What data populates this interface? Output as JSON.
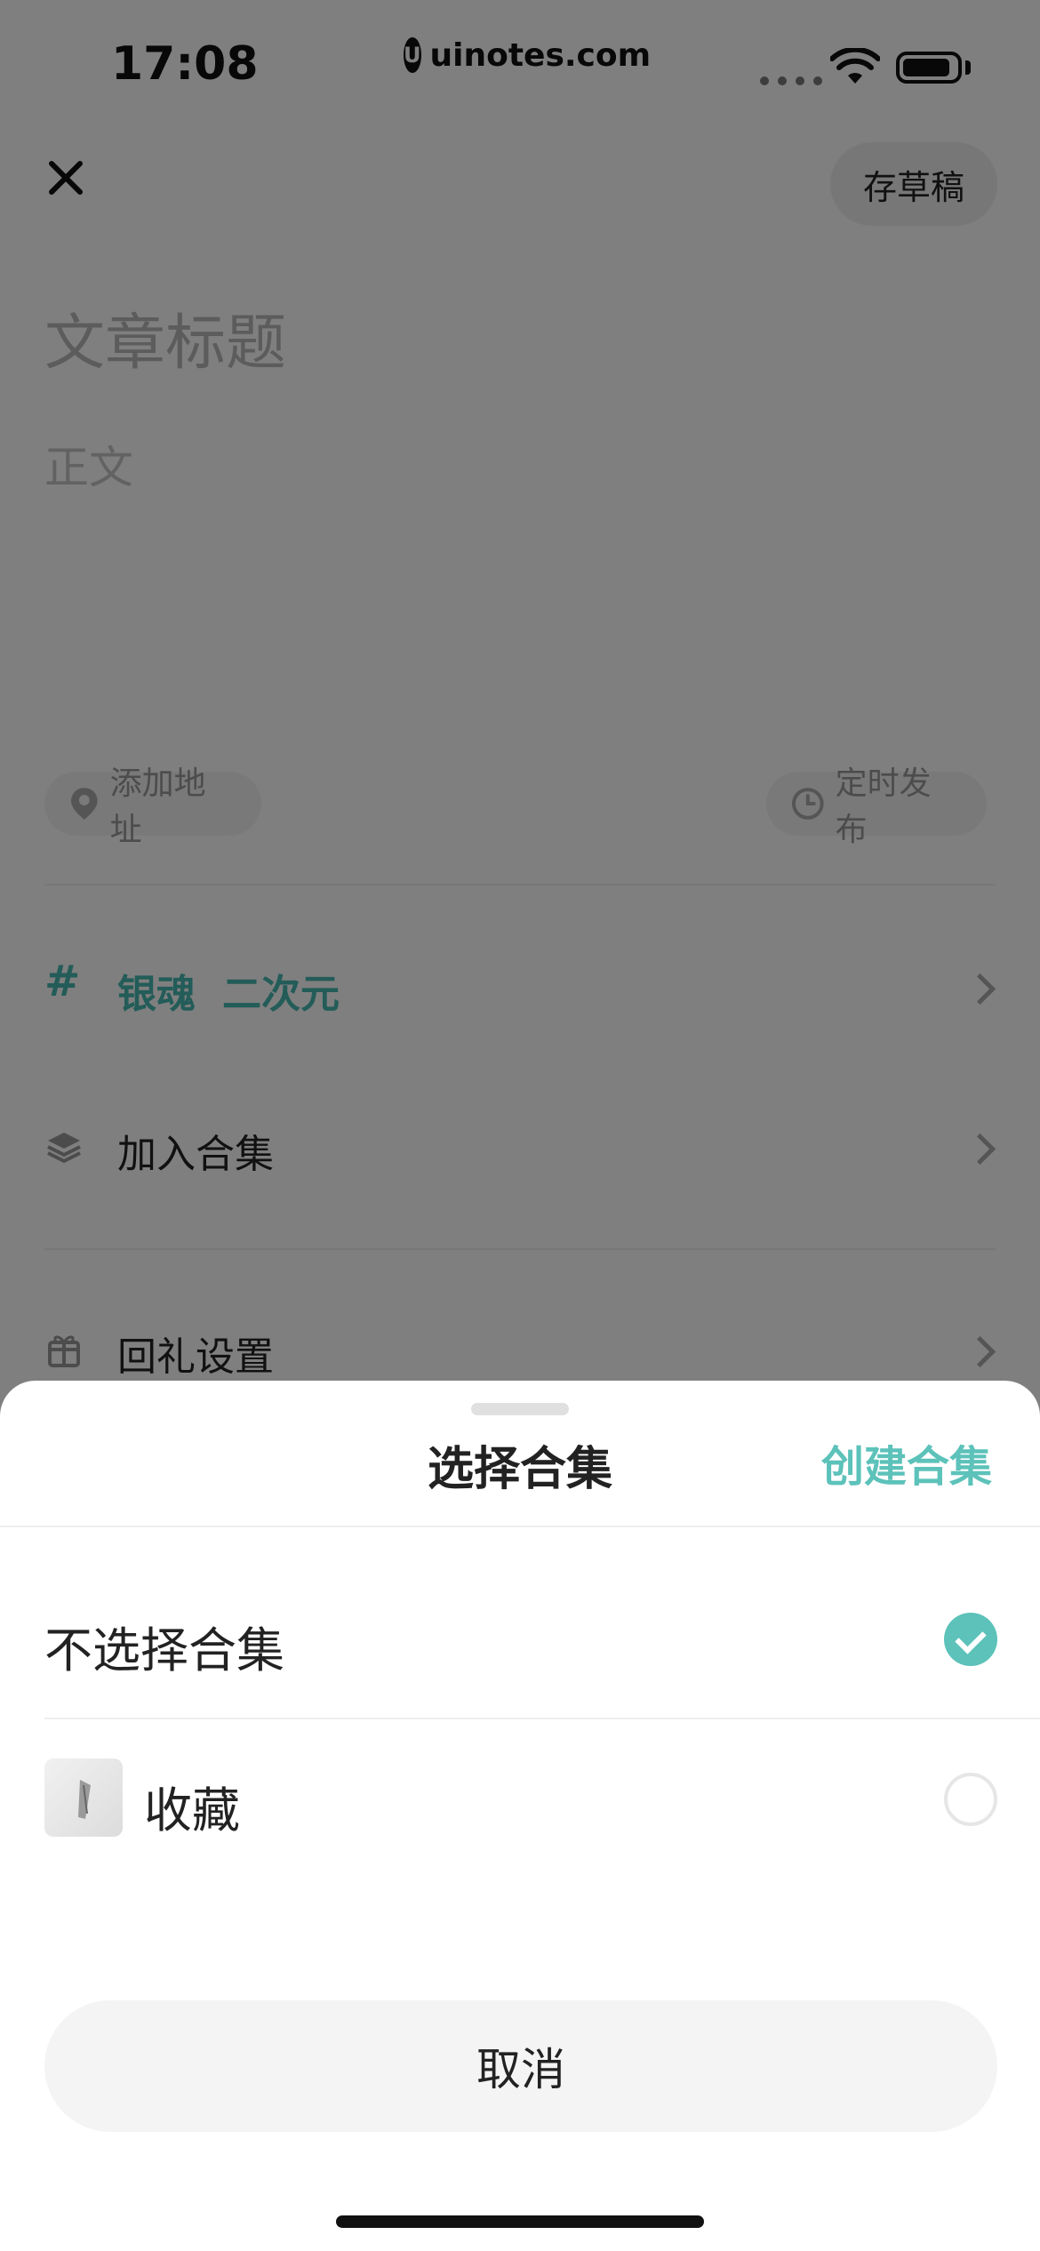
{
  "status_bar": {
    "time": "17:08",
    "site": "uinotes.com",
    "site_logo_letter": "U"
  },
  "editor": {
    "draft_button": "存草稿",
    "title_placeholder": "文章标题",
    "body_placeholder": "正文",
    "add_location": "添加地址",
    "schedule_publish": "定时发布",
    "tags": [
      "银魂",
      "二次元"
    ],
    "add_to_collection": "加入合集",
    "gift_settings": "回礼设置"
  },
  "sheet": {
    "title": "选择合集",
    "create_link": "创建合集",
    "options": [
      {
        "label": "不选择合集",
        "selected": true
      },
      {
        "label": "收藏",
        "selected": false
      }
    ],
    "cancel": "取消"
  },
  "colors": {
    "accent": "#5cc2ba",
    "tag": "#47b9b0",
    "overlay": "rgba(0,0,0,0.5)"
  },
  "icons": [
    "close-icon",
    "location-pin-icon",
    "clock-icon",
    "hashtag-icon",
    "layers-icon",
    "gift-icon",
    "chevron-right-icon",
    "check-icon",
    "wifi-icon",
    "battery-icon"
  ]
}
